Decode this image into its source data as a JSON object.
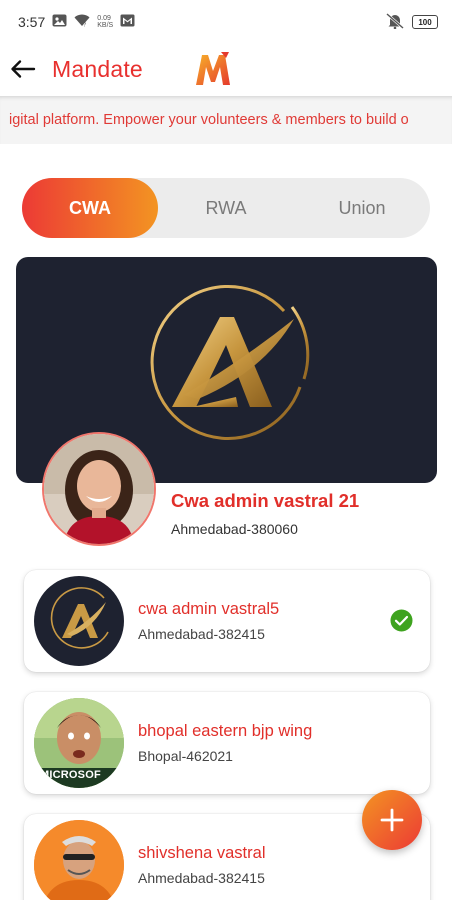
{
  "status_bar": {
    "time": "3:57",
    "net_speed_top": "0.09",
    "net_speed_bottom": "KB/S",
    "battery": "100",
    "icons": [
      "image-icon",
      "wifi-icon",
      "network-speed-icon",
      "gmail-icon",
      "mute-icon",
      "battery-icon"
    ]
  },
  "app_bar": {
    "title": "Mandate",
    "logo_letter": "M",
    "back_icon": "arrow-left-icon"
  },
  "marquee": {
    "text": "igital platform. Empower your volunteers & members to build o"
  },
  "tabs": [
    {
      "label": "CWA",
      "active": true
    },
    {
      "label": "RWA",
      "active": false
    },
    {
      "label": "Union",
      "active": false
    }
  ],
  "profile": {
    "name": "Cwa admin vastral 21",
    "location": "Ahmedabad-380060"
  },
  "list": [
    {
      "title": "cwa admin vastral5",
      "location": "Ahmedabad-382415",
      "selected": true
    },
    {
      "title": "bhopal eastern bjp wing",
      "location": "Bhopal-462021",
      "avatar_text": "MICROSOF",
      "selected": false
    },
    {
      "title": "shivshena vastral",
      "location": "Ahmedabad-382415",
      "selected": false
    }
  ],
  "colors": {
    "accent": "#e12f2a",
    "gradient_start": "#ec3a35",
    "gradient_end": "#f39422",
    "banner_bg": "#1e2230",
    "gold": "#c99a45",
    "check_green": "#3ea31f"
  },
  "fab": {
    "icon": "plus-icon"
  }
}
